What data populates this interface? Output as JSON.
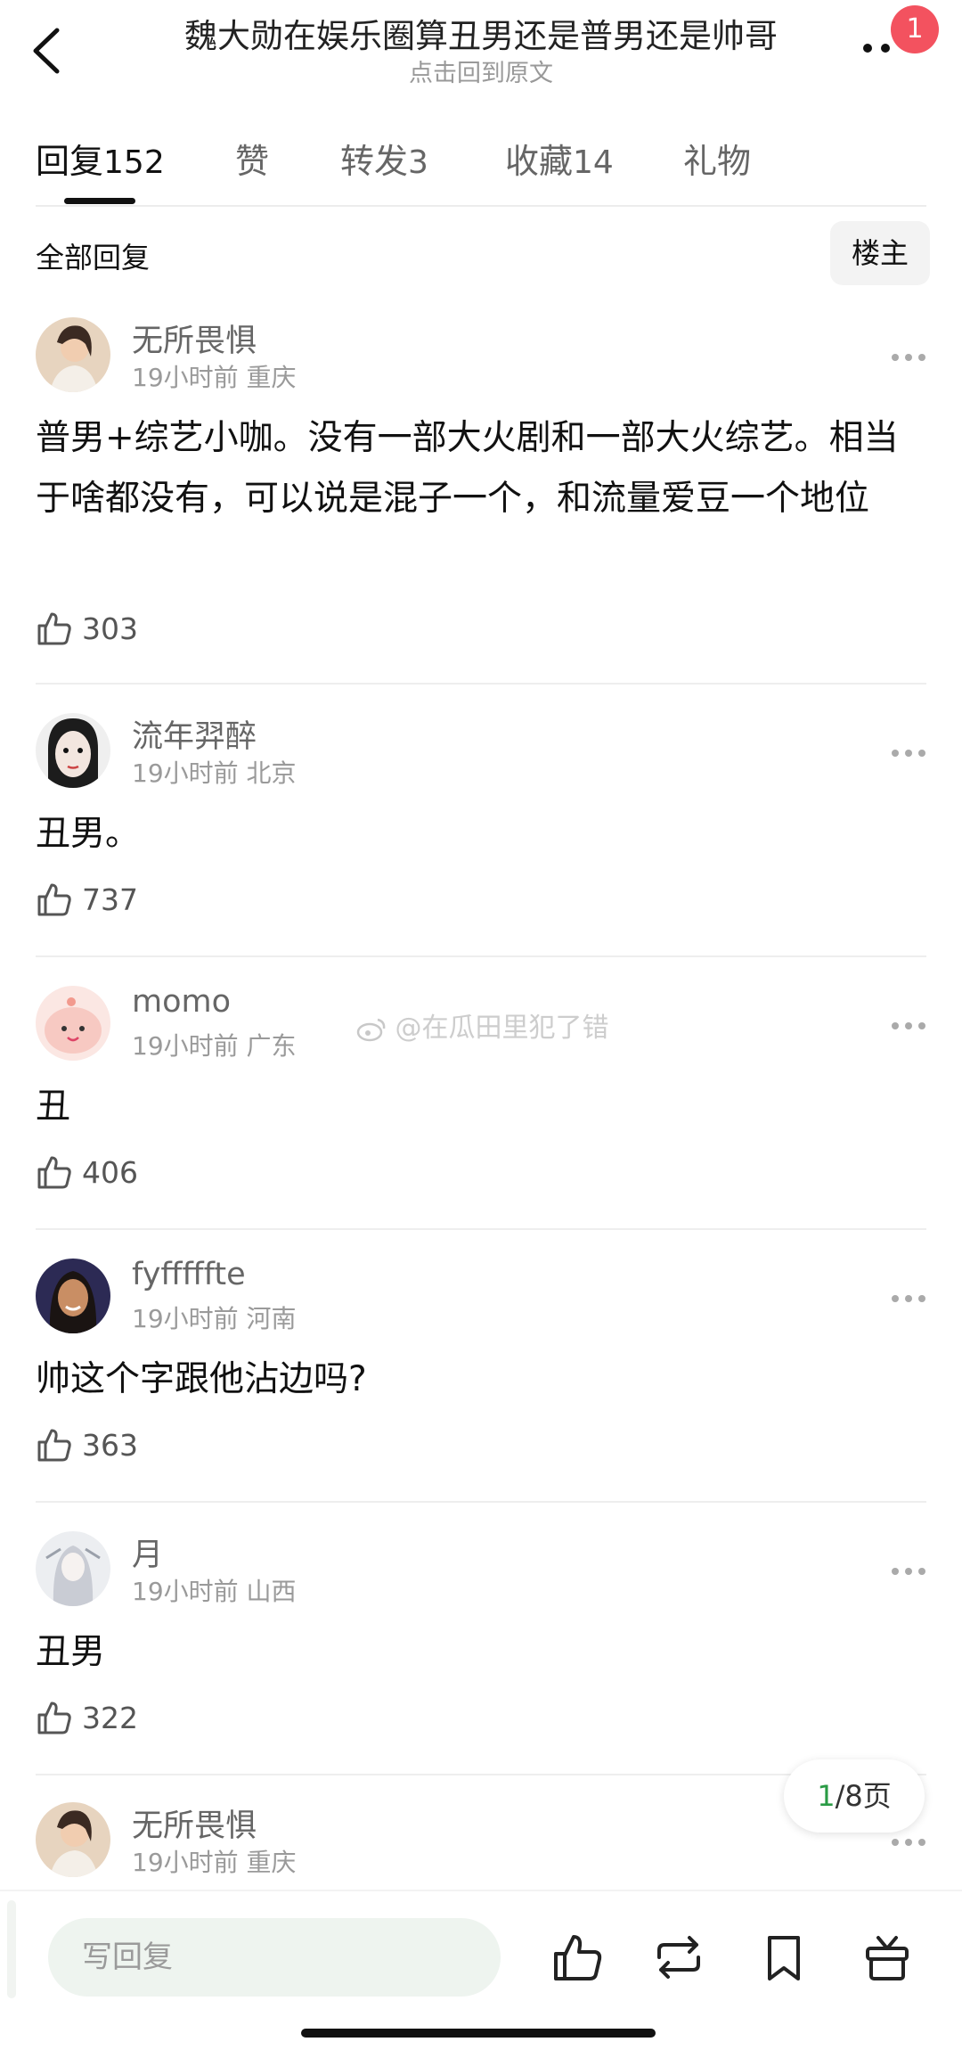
{
  "header": {
    "title": "魏大勋在娱乐圈算丑男还是普男还是帅哥",
    "subtitle": "点击回到原文",
    "badge": "1"
  },
  "tabs": [
    {
      "label": "回复",
      "count": "152"
    },
    {
      "label": "赞",
      "count": ""
    },
    {
      "label": "转发",
      "count": "3"
    },
    {
      "label": "收藏",
      "count": "14"
    },
    {
      "label": "礼物",
      "count": ""
    }
  ],
  "section": {
    "title": "全部回复",
    "filter_button": "楼主"
  },
  "comments": [
    {
      "name": "无所畏惧",
      "time": "19小时前",
      "location": "重庆",
      "text": "普男+综艺小咖。没有一部大火剧和一部大火综艺。相当于啥都没有，可以说是混子一个，和流量爱豆一个地位",
      "likes": "303",
      "avatar_color": "#d9b08c"
    },
    {
      "name": "流年羿醉",
      "time": "19小时前",
      "location": "北京",
      "text": "丑男。",
      "likes": "737",
      "avatar_color": "#cfcfcf"
    },
    {
      "name": "momo",
      "time": "19小时前",
      "location": "广东",
      "text": "丑",
      "likes": "406",
      "avatar_color": "#f6c7c0"
    },
    {
      "name": "fyfffffte",
      "time": "19小时前",
      "location": "河南",
      "text": "帅这个字跟他沾边吗?",
      "likes": "363",
      "avatar_color": "#3a3050"
    },
    {
      "name": "月",
      "time": "19小时前",
      "location": "山西",
      "text": "丑男",
      "likes": "322",
      "avatar_color": "#e6e9ec"
    },
    {
      "name": "无所畏惧",
      "time": "19小时前",
      "location": "重庆",
      "text": "",
      "likes": "",
      "avatar_color": "#d9b08c"
    }
  ],
  "watermark": "@在瓜田里犯了错",
  "pager": {
    "current": "1",
    "total": "/8页"
  },
  "bottom": {
    "placeholder": "写回复"
  }
}
